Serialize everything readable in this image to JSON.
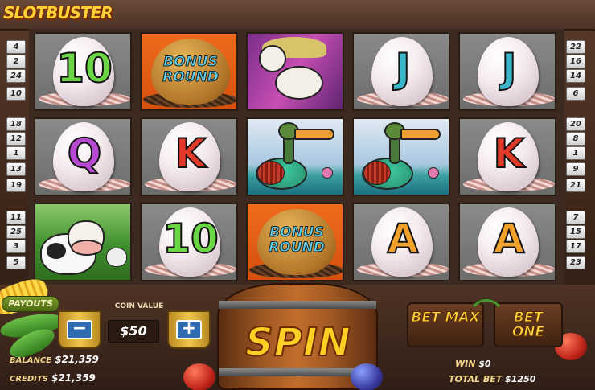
{
  "logo": "SLOTBUSTER",
  "lines_left": [
    "4",
    "2",
    "24",
    "10",
    "18",
    "12",
    "1",
    "13",
    "19",
    "11",
    "25",
    "3",
    "5"
  ],
  "lines_right": [
    "22",
    "16",
    "14",
    "6",
    "20",
    "8",
    "1",
    "9",
    "21",
    "7",
    "15",
    "17",
    "23"
  ],
  "reels": [
    [
      {
        "kind": "letter",
        "text": "10",
        "cls": "s-10"
      },
      {
        "kind": "letter",
        "text": "Q",
        "cls": "s-Q"
      },
      {
        "kind": "cow"
      }
    ],
    [
      {
        "kind": "bonus",
        "text": "BONUS ROUND"
      },
      {
        "kind": "letter",
        "text": "K",
        "cls": "s-K"
      },
      {
        "kind": "letter",
        "text": "10",
        "cls": "s-10"
      }
    ],
    [
      {
        "kind": "horse"
      },
      {
        "kind": "duck"
      },
      {
        "kind": "bonus",
        "text": "BONUS ROUND"
      }
    ],
    [
      {
        "kind": "letter",
        "text": "J",
        "cls": "s-J"
      },
      {
        "kind": "duck"
      },
      {
        "kind": "letter",
        "text": "A",
        "cls": "s-A"
      }
    ],
    [
      {
        "kind": "letter",
        "text": "J",
        "cls": "s-J"
      },
      {
        "kind": "letter",
        "text": "K",
        "cls": "s-K"
      },
      {
        "kind": "letter",
        "text": "A",
        "cls": "s-A"
      }
    ]
  ],
  "payouts_label": "PAYOUTS",
  "coin": {
    "label": "COIN VALUE",
    "value": "$50",
    "minus": "−",
    "plus": "+"
  },
  "balance": {
    "label": "BALANCE",
    "value": "$21,359"
  },
  "credits": {
    "label": "CREDITS",
    "value": "$21,359"
  },
  "spin_label": "SPIN",
  "bet_max_label": "BET MAX",
  "bet_one_label": "BET ONE",
  "win": {
    "label": "WIN",
    "value": "$0"
  },
  "total_bet": {
    "label": "TOTAL BET",
    "value": "$1250"
  }
}
